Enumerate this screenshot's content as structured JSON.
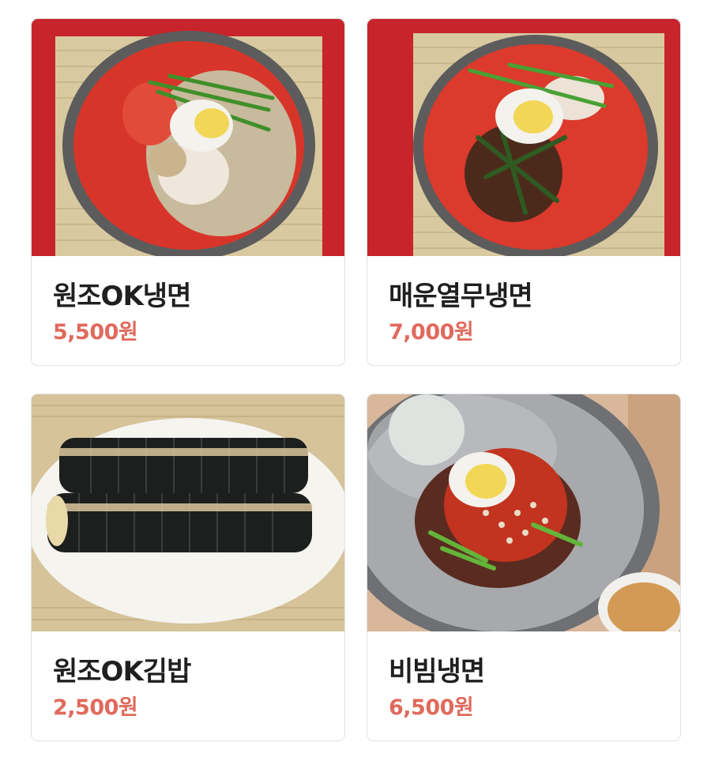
{
  "menu": {
    "items": [
      {
        "name": "원조OK냉면",
        "price": "5,500원",
        "image": "mul-naengmyeon-photo"
      },
      {
        "name": "매운열무냉면",
        "price": "7,000원",
        "image": "spicy-yeolmu-naengmyeon-photo"
      },
      {
        "name": "원조OK김밥",
        "price": "2,500원",
        "image": "gimbap-photo"
      },
      {
        "name": "비빔냉면",
        "price": "6,500원",
        "image": "bibim-naengmyeon-photo"
      }
    ]
  },
  "colors": {
    "price": "#e06a5c",
    "title": "#1f1f1f",
    "card_border": "#e2e2e2"
  }
}
